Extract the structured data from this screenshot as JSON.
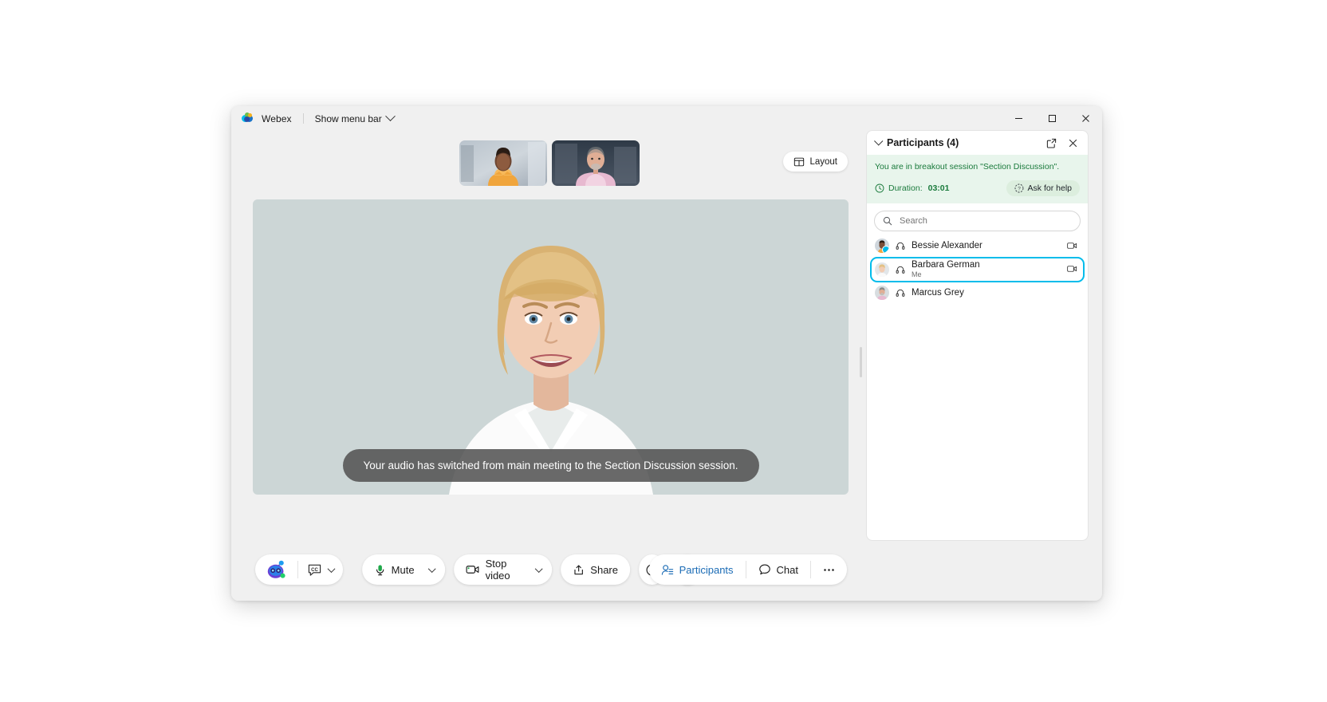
{
  "window": {
    "app_name": "Webex",
    "menu_label": "Show menu bar",
    "controls": {
      "minimize": "minimize-icon",
      "maximize": "maximize-icon",
      "close": "close-icon"
    }
  },
  "stage": {
    "layout_button": "Layout",
    "toast_message": "Your audio has switched from main meeting to the Section Discussion session.",
    "thumbnails": [
      {
        "name": "participant-thumbnail-1"
      },
      {
        "name": "participant-thumbnail-2"
      }
    ]
  },
  "toolbar": {
    "assistant_icon": "assistant-bot-icon",
    "closed_captions_icon": "closed-captions-icon",
    "cc_caret": "chevron-down-icon",
    "mute_label": "Mute",
    "mute_icon": "microphone-icon",
    "video_label": "Stop video",
    "video_icon": "camera-icon",
    "share_label": "Share",
    "share_icon": "share-screen-icon",
    "reactions_icon": "emoji-reaction-icon",
    "more_icon": "more-options-icon",
    "leave_icon": "leave-meeting-icon",
    "participants_label": "Participants",
    "participants_icon": "participants-icon",
    "chat_label": "Chat",
    "chat_icon": "chat-bubble-icon",
    "panel_more_icon": "more-options-icon"
  },
  "panel": {
    "title": "Participants (4)",
    "collapse_icon": "chevron-down-icon",
    "popout_icon": "pop-out-icon",
    "close_icon": "close-icon",
    "breakout": {
      "message": "You are in breakout session \"Section Discussion\".",
      "duration_label": "Duration:",
      "duration_value": "03:01",
      "clock_icon": "clock-icon",
      "ask_help_label": "Ask for help",
      "ask_help_icon": "help-icon"
    },
    "search": {
      "placeholder": "Search",
      "value": "",
      "icon": "search-icon"
    },
    "participants": [
      {
        "name": "Bessie Alexander",
        "subtitle": "",
        "audio_icon": "headset-icon",
        "video_icon": "camera-off-icon",
        "selected": false,
        "has_badge": true
      },
      {
        "name": "Barbara German",
        "subtitle": "Me",
        "audio_icon": "headset-icon",
        "video_icon": "camera-off-icon",
        "selected": true,
        "has_badge": false
      },
      {
        "name": "Marcus Grey",
        "subtitle": "",
        "audio_icon": "headset-icon",
        "video_icon": "",
        "selected": false,
        "has_badge": false
      }
    ]
  },
  "colors": {
    "accent": "#00bceb",
    "breakout_bg": "#e8f5ec",
    "breakout_text": "#1a7a3c",
    "leave_red": "#d6401f",
    "mic_green": "#1fa84a"
  }
}
